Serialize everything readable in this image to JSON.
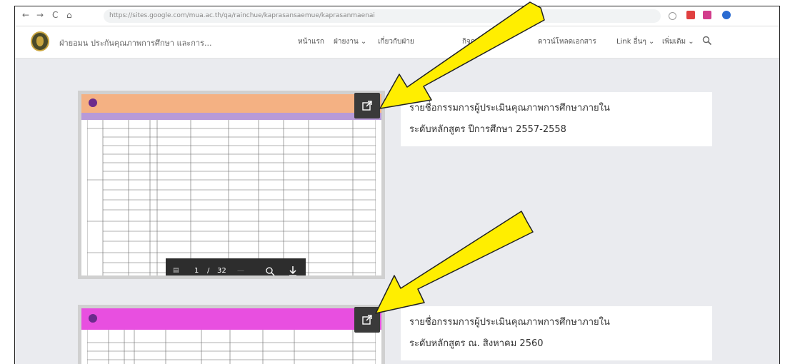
{
  "browser": {
    "back": "←",
    "forward": "→",
    "reload": "C",
    "home": "⌂",
    "url": "https://sites.google.com/mua.ac.th/qa/rainchue/kaprasansaemue/kaprasanmaenai"
  },
  "site": {
    "title": "ฝ่ายอมน ประกันคุณภาพการศึกษา และการ...",
    "menu": [
      {
        "label": "หน้าแรก"
      },
      {
        "label": "ฝ่ายงาน ⌄"
      },
      {
        "label": "เกี่ยวกับฝ่าย"
      },
      {
        "label": "กิจกรรม ⌄"
      },
      {
        "label": "ดาวน์โหลดเอกสาร"
      },
      {
        "label": "Link อื่นๆ ⌄"
      },
      {
        "label": "เพิ่มเติม ⌄"
      }
    ],
    "search_icon": "search-icon"
  },
  "items": [
    {
      "line1": "รายชื่อกรรมการผู้ประเมินคุณภาพการศึกษาภายใน",
      "line2": "ระดับหลักสูตร   ปีการศึกษา 2557-2558",
      "header_color": "#f4b183",
      "pdf_toolbar": {
        "page": "1",
        "sep": "/",
        "total": "32"
      }
    },
    {
      "line1": "รายชื่อกรรมการผู้ประเมินคุณภาพการศึกษาภายใน",
      "line2": "ระดับหลักสูตร   ณ. สิงหาคม 2560",
      "header_color": "#e84fe0"
    }
  ],
  "colors": {
    "arrow_fill": "#ffee00",
    "arrow_stroke": "#222222"
  }
}
